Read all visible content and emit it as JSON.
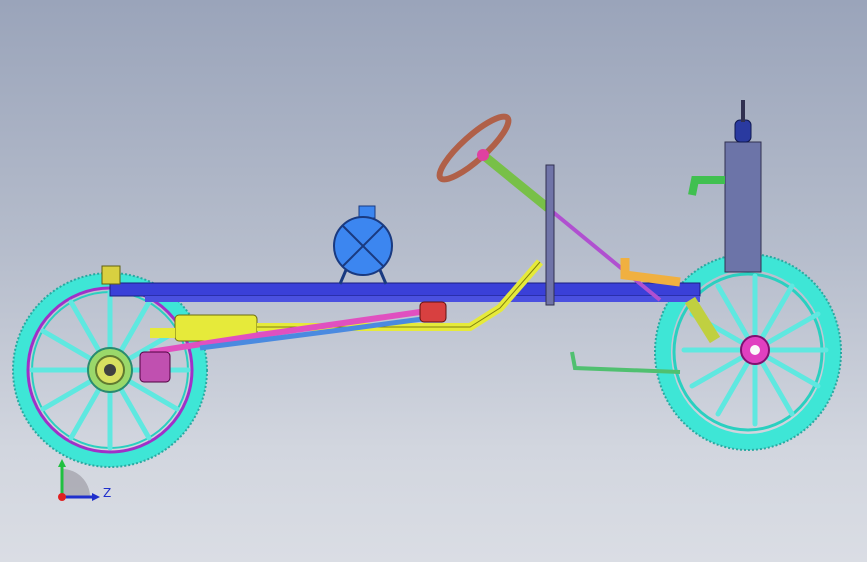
{
  "viewport": {
    "axis_label": "Z"
  },
  "model": {
    "parts": [
      "front-wheel",
      "rear-wheel",
      "frame-rail",
      "fuel-tank",
      "steering-wheel",
      "steering-column",
      "radiator",
      "exhaust-pipe",
      "muffler",
      "drive-shaft",
      "gear-lever",
      "pedal-rod"
    ]
  },
  "colors": {
    "background_top": "#9aa4ba",
    "background_bottom": "#dadde4",
    "frame": "#3a40d8",
    "tire": "#3ee6d6",
    "spoke": "#5fe8e0",
    "rim_inner": "#a030c8",
    "hub": "#e040c0",
    "tank": "#3c86f0",
    "exhaust": "#e6ea3a",
    "steering": "#b06048",
    "radiator": "#6c74a8",
    "triad_y": "#20c040",
    "triad_z": "#1f2fcc"
  }
}
